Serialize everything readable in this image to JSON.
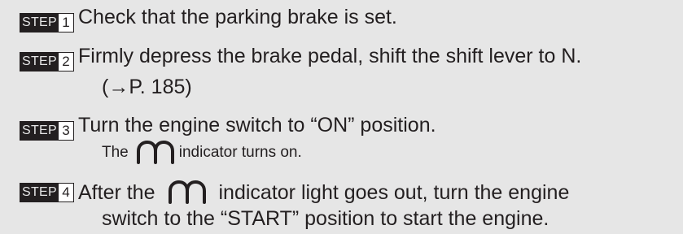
{
  "steps": [
    {
      "word": "STEP",
      "num": "1",
      "text": "Check that the parking brake is set."
    },
    {
      "word": "STEP",
      "num": "2",
      "text": "Firmly depress the brake pedal, shift the shift lever to N.",
      "text2": "(→P. 185)"
    },
    {
      "word": "STEP",
      "num": "3",
      "text": "Turn the engine switch to “ON” position.",
      "note_pre": "The",
      "note_post": "indicator turns on."
    },
    {
      "word": "STEP",
      "num": "4",
      "text_pre": "After the",
      "text_post": "indicator light goes out, turn the engine",
      "text2": "switch to the “START” position to start the engine."
    }
  ],
  "icons": {
    "glow_plug": "glow-plug-indicator-icon"
  }
}
